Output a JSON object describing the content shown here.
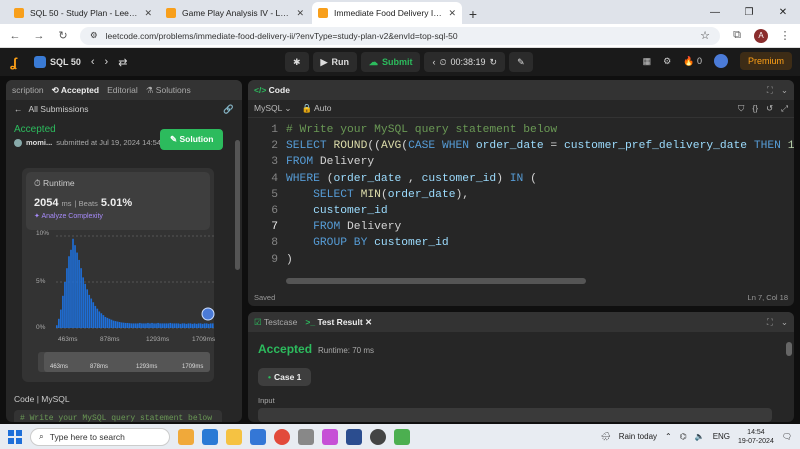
{
  "browser": {
    "tabs": [
      {
        "title": "SQL 50 - Study Plan - LeetCode",
        "active": false
      },
      {
        "title": "Game Play Analysis IV - LeetCo",
        "active": false
      },
      {
        "title": "Immediate Food Delivery II - Le",
        "active": true
      }
    ],
    "new_tab": "+",
    "url": "leetcode.com/problems/immediate-food-delivery-ii/?envType=study-plan-v2&envId=top-sql-50",
    "profile_initial": "A"
  },
  "header": {
    "plan": "SQL 50",
    "run": "Run",
    "submit": "Submit",
    "timer": "00:38:19",
    "coins": "0",
    "premium": "Premium"
  },
  "left": {
    "tabs": [
      "scription",
      "Accepted",
      "Editorial",
      "Solutions"
    ],
    "back": "All Submissions",
    "status": "Accepted",
    "user": "momi...",
    "submitted": "submitted at Jul 19, 2024 14:54",
    "solution_btn": "Solution",
    "runtime_label": "Runtime",
    "runtime_value": "2054",
    "runtime_unit": "ms",
    "beats_label": "Beats",
    "beats_value": "5.01%",
    "analyze": "Analyze Complexity",
    "chart_data": {
      "type": "bar",
      "yticks": [
        "10%",
        "5%",
        "0%"
      ],
      "xticks": [
        "463ms",
        "878ms",
        "1293ms",
        "1709ms"
      ],
      "mini_xticks": [
        "463ms",
        "878ms",
        "1293ms",
        "1709ms"
      ],
      "ylim": [
        0,
        10
      ],
      "values": [
        0.3,
        1,
        2,
        3.5,
        5,
        6.5,
        7.8,
        8.5,
        9.7,
        9,
        8.2,
        7.4,
        6.5,
        5.5,
        4.8,
        4.2,
        3.6,
        3.2,
        2.8,
        2.4,
        2.1,
        1.8,
        1.6,
        1.4,
        1.2,
        1.1,
        1,
        0.9,
        0.8,
        0.75,
        0.7,
        0.65,
        0.6,
        0.58,
        0.55,
        0.55,
        0.52,
        0.5,
        0.5,
        0.5,
        0.5,
        0.55,
        0.5,
        0.5,
        0.5,
        0.55,
        0.5,
        0.55,
        0.5,
        0.5,
        0.55,
        0.5,
        0.5,
        0.5,
        0.5,
        0.5,
        0.55,
        0.5,
        0.5,
        0.5,
        0.5,
        0.45,
        0.5,
        0.5,
        0.45,
        0.5,
        0.5,
        0.45,
        0.5,
        0.45,
        0.5,
        0.5,
        0.45,
        0.5,
        0.5,
        0.45,
        0.5,
        0.5
      ],
      "highlight_index": 78
    },
    "code_header": "Code",
    "code_lang": "MySQL",
    "code_preview": "# Write your MySQL query statement below"
  },
  "code": {
    "title": "Code",
    "lang": "MySQL",
    "auto": "Auto",
    "lines": [
      {
        "n": "1",
        "parts": [
          [
            "c",
            "# Write your MySQL query statement below"
          ]
        ]
      },
      {
        "n": "2",
        "parts": [
          [
            "k",
            "SELECT "
          ],
          [
            "f",
            "ROUND"
          ],
          [
            "t",
            "(("
          ],
          [
            "f",
            "AVG"
          ],
          [
            "t",
            "("
          ],
          [
            "k",
            "CASE WHEN "
          ],
          [
            "v",
            "order_date"
          ],
          [
            "t",
            " = "
          ],
          [
            "v",
            "customer_pref_delivery_date"
          ],
          [
            "k",
            " THEN "
          ],
          [
            "n",
            "1"
          ]
        ]
      },
      {
        "n": "3",
        "parts": [
          [
            "k",
            "FROM "
          ],
          [
            "t",
            "Delivery"
          ]
        ]
      },
      {
        "n": "4",
        "parts": [
          [
            "k",
            "WHERE "
          ],
          [
            "t",
            "("
          ],
          [
            "v",
            "order_date"
          ],
          [
            "t",
            " , "
          ],
          [
            "v",
            "customer_id"
          ],
          [
            "t",
            ") "
          ],
          [
            "k",
            "IN "
          ],
          [
            "t",
            "("
          ]
        ]
      },
      {
        "n": "5",
        "parts": [
          [
            "t",
            "    "
          ],
          [
            "k",
            "SELECT "
          ],
          [
            "f",
            "MIN"
          ],
          [
            "t",
            "("
          ],
          [
            "v",
            "order_date"
          ],
          [
            "t",
            "),"
          ]
        ]
      },
      {
        "n": "6",
        "parts": [
          [
            "t",
            "    "
          ],
          [
            "v",
            "customer_id"
          ]
        ]
      },
      {
        "n": "7",
        "parts": [
          [
            "t",
            "    "
          ],
          [
            "k",
            "FROM "
          ],
          [
            "t",
            "Delivery"
          ]
        ]
      },
      {
        "n": "8",
        "parts": [
          [
            "t",
            "    "
          ],
          [
            "k",
            "GROUP BY "
          ],
          [
            "v",
            "customer_id"
          ]
        ]
      },
      {
        "n": "9",
        "parts": [
          [
            "t",
            ")"
          ]
        ]
      }
    ],
    "current_line": "7",
    "saved": "Saved",
    "position": "Ln 7, Col 18"
  },
  "testcase": {
    "tab1": "Testcase",
    "tab2": "Test Result",
    "status": "Accepted",
    "runtime": "Runtime: 70 ms",
    "case": "Case 1",
    "input_label": "Input"
  },
  "taskbar": {
    "search": "Type here to search",
    "weather": "Rain today",
    "lang": "ENG",
    "time": "14:54",
    "date": "19-07-2024"
  }
}
